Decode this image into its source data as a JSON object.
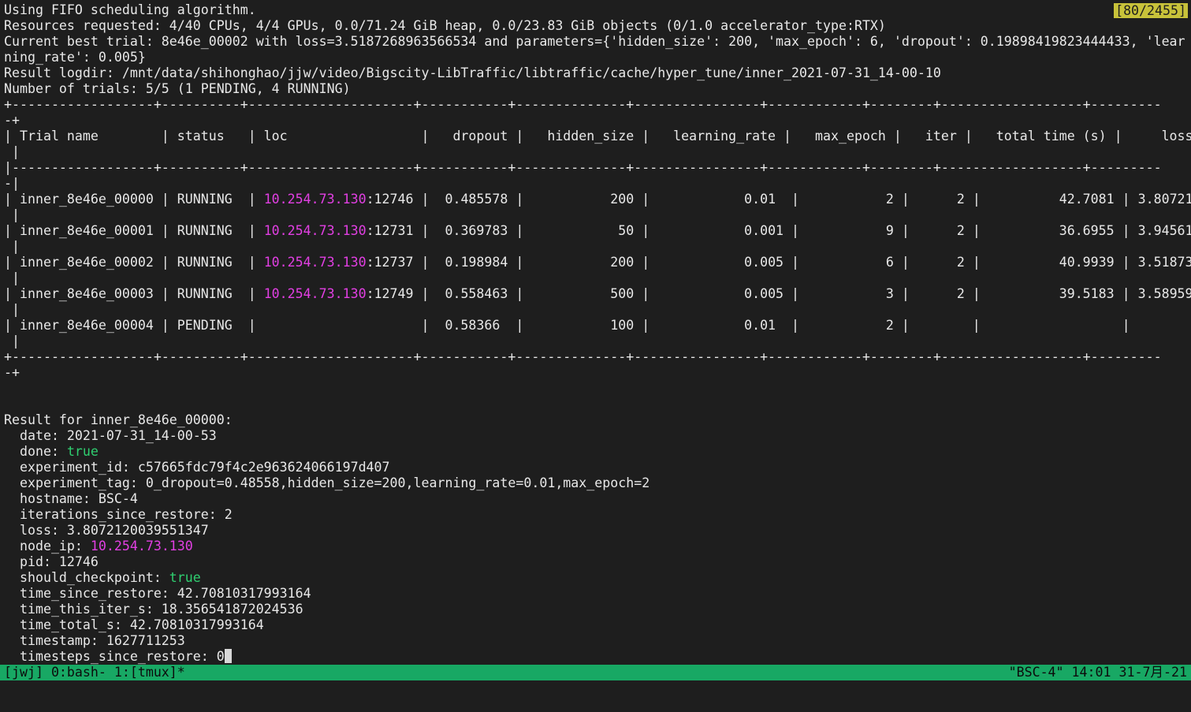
{
  "scroll_indicator": "[80/2455]",
  "header": {
    "line1": "Using FIFO scheduling algorithm.",
    "line2": "Resources requested: 4/40 CPUs, 4/4 GPUs, 0.0/71.24 GiB heap, 0.0/23.83 GiB objects (0/1.0 accelerator_type:RTX)",
    "line3": "Current best trial: 8e46e_00002 with loss=3.5187268963566534 and parameters={'hidden_size': 200, 'max_epoch': 6, 'dropout': 0.19898419823444433, 'lear",
    "line4": "ning_rate': 0.005}",
    "line5": "Result logdir: /mnt/data/shihonghao/jjw/video/Bigscity-LibTraffic/libtraffic/cache/hyper_tune/inner_2021-07-31_14-00-10",
    "line6": "Number of trials: 5/5 (1 PENDING, 4 RUNNING)"
  },
  "table": {
    "border": "+------------------+----------+---------------------+-----------+--------------+----------------+------------+--------+------------------+---------",
    "border_wrap": "-+",
    "header_row": "| Trial name        | status   | loc                 |   dropout |   hidden_size |   learning_rate |   max_epoch |   iter |   total time (s) |     loss",
    "header_wrap": " |",
    "separator": "|------------------+----------+---------------------+-----------+--------------+----------------+------------+--------+------------------+---------",
    "separator_wrap": "-|",
    "row_wrap": " |",
    "rows": [
      {
        "pre": "| inner_8e46e_00000 | RUNNING  | ",
        "ip": "10.254.73.130",
        "post": ":12746 |  0.485578 |           200 |            0.01  |           2 |      2 |          42.7081 | 3.80721"
      },
      {
        "pre": "| inner_8e46e_00001 | RUNNING  | ",
        "ip": "10.254.73.130",
        "post": ":12731 |  0.369783 |            50 |            0.001 |           9 |      2 |          36.6955 | 3.94561"
      },
      {
        "pre": "| inner_8e46e_00002 | RUNNING  | ",
        "ip": "10.254.73.130",
        "post": ":12737 |  0.198984 |           200 |            0.005 |           6 |      2 |          40.9939 | 3.51873"
      },
      {
        "pre": "| inner_8e46e_00003 | RUNNING  | ",
        "ip": "10.254.73.130",
        "post": ":12749 |  0.558463 |           500 |            0.005 |           3 |      2 |          39.5183 | 3.58959"
      },
      {
        "pre": "| inner_8e46e_00004 | PENDING  |                     |  0.58366  |           100 |            0.01  |           2 |        |                  |",
        "ip": "",
        "post": ""
      }
    ]
  },
  "result": {
    "title": "Result for inner_8e46e_00000:",
    "date": "  date: 2021-07-31_14-00-53",
    "done_key": "  done: ",
    "done_val": "true",
    "experiment_id": "  experiment_id: c57665fdc79f4c2e963624066197d407",
    "experiment_tag": "  experiment_tag: 0_dropout=0.48558,hidden_size=200,learning_rate=0.01,max_epoch=2",
    "hostname": "  hostname: BSC-4",
    "iterations_since_restore": "  iterations_since_restore: 2",
    "loss": "  loss: 3.8072120039551347",
    "node_ip_key": "  node_ip: ",
    "node_ip_val": "10.254.73.130",
    "pid": "  pid: 12746",
    "should_checkpoint_key": "  should_checkpoint: ",
    "should_checkpoint_val": "true",
    "time_since_restore": "  time_since_restore: 42.70810317993164",
    "time_this_iter_s": "  time_this_iter_s: 18.356541872024536",
    "time_total_s": "  time_total_s: 42.70810317993164",
    "timestamp": "  timestamp: 1627711253",
    "timesteps_since_restore": "  timesteps_since_restore: 0"
  },
  "status_bar": {
    "left": "[jwj] 0:bash- 1:[tmux]*",
    "right": "\"BSC-4\" 14:01 31-7月-21"
  },
  "colors": {
    "background": "#1e1e1e",
    "foreground": "#e8e8e8",
    "ip_magenta": "#e23fe3",
    "true_green": "#2fcf70",
    "status_bar_green": "#18a864",
    "indicator_yellow": "#c8c23a"
  }
}
